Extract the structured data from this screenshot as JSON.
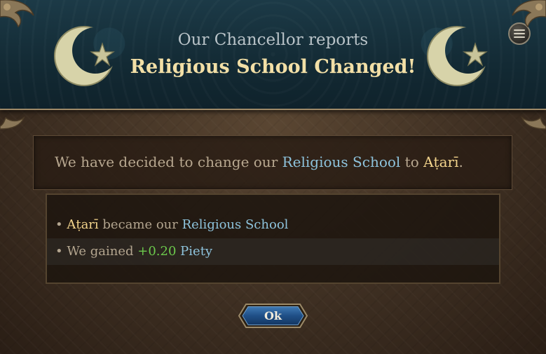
{
  "header": {
    "subtitle": "Our Chancellor reports",
    "title": "Religious School Changed!",
    "emblem_icon": "crescent-star-icon",
    "menu_icon": "hamburger-menu-icon"
  },
  "message": {
    "prefix": "We have decided to change our ",
    "school_link": "Religious School",
    "middle": " to ",
    "school_name": "Aṭarī",
    "suffix": "."
  },
  "effects": [
    {
      "bullet": "• ",
      "name": "Aṭarī",
      "text": " became our ",
      "link": "Religious School"
    },
    {
      "bullet": "• ",
      "text": "We gained ",
      "value": "+0.20",
      "link": "Piety"
    }
  ],
  "ok_button": {
    "label": "Ok"
  },
  "colors": {
    "header_bg": "#132a34",
    "title_gold": "#f2dfa6",
    "link_blue": "#8ec3dc",
    "name_gold": "#f3d48c",
    "positive_green": "#6cc94c",
    "button_blue": "#1f4f86"
  }
}
